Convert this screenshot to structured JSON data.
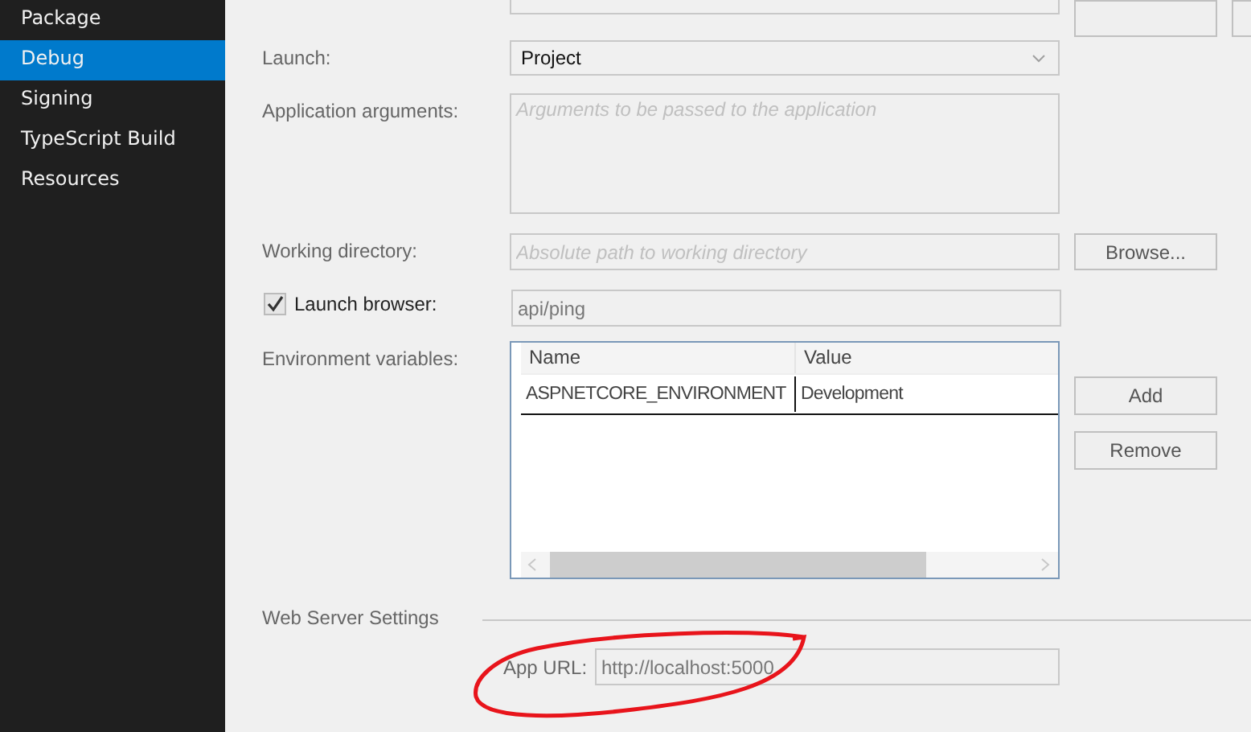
{
  "sidebar": {
    "items": [
      {
        "label": "Package",
        "selected": false
      },
      {
        "label": "Debug",
        "selected": true
      },
      {
        "label": "Signing",
        "selected": false
      },
      {
        "label": "TypeScript Build",
        "selected": false
      },
      {
        "label": "Resources",
        "selected": false
      }
    ]
  },
  "launch": {
    "label": "Launch:",
    "value": "Project"
  },
  "application_arguments": {
    "label": "Application arguments:",
    "placeholder": "Arguments to be passed to the application"
  },
  "working_directory": {
    "label": "Working directory:",
    "placeholder": "Absolute path to working directory",
    "button": "Browse..."
  },
  "launch_browser": {
    "label": "Launch browser:",
    "checked": true,
    "value": "api/ping"
  },
  "environment_variables": {
    "label": "Environment variables:",
    "columns": [
      "Name",
      "Value"
    ],
    "rows": [
      [
        "ASPNETCORE_ENVIRONMENT",
        "Development"
      ]
    ],
    "buttons": [
      "Add",
      "Remove"
    ]
  },
  "web_server_settings": {
    "title": "Web Server Settings",
    "app_url": {
      "label": "App URL:",
      "value": "http://localhost:5000"
    }
  }
}
